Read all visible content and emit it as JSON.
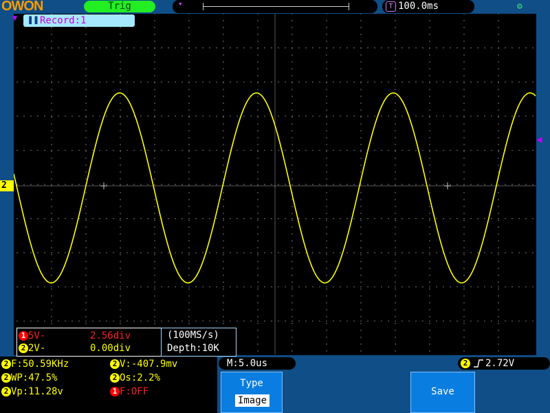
{
  "header": {
    "logo": "OWON",
    "trigger_status": "Trig",
    "timebase": "100.0ms",
    "icons": {
      "trigger_position": "trigger-position-icon",
      "time": "time-icon",
      "usb": "usb-icon"
    }
  },
  "screen": {
    "record_label": "Record:1",
    "channel2_marker": "2"
  },
  "channels": {
    "ch1": {
      "badge": "1",
      "scale": "5V-",
      "offset": "2.56div"
    },
    "ch2": {
      "badge": "2",
      "scale": "2V-",
      "offset": "0.00div"
    }
  },
  "acquisition": {
    "sample_rate": "(100MS/s)",
    "depth": "Depth:10K"
  },
  "measurements": {
    "frequency": "F:50.59KHz",
    "voltage": "V:-407.9mv",
    "width_positive": "WP:47.5%",
    "overshoot": "Os:2.2%",
    "vpp": "Vp:11.28v",
    "ch1_frequency": "F:OFF"
  },
  "horizontal": {
    "delay": "M:5.0us"
  },
  "trigger": {
    "channel": "2",
    "level": "2.72V"
  },
  "menu": {
    "type_label": "Type",
    "type_value": "Image",
    "save_label": "Save"
  },
  "waveform": {
    "color": "#ffff00",
    "frequency_hz": 50590,
    "vpp": 11.28
  }
}
